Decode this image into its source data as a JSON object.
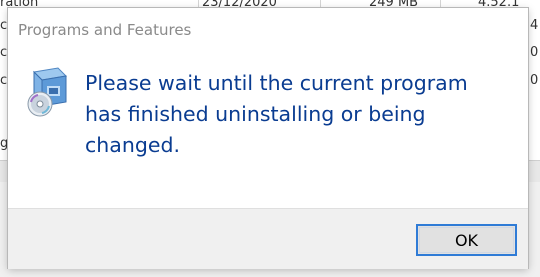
{
  "background_list": {
    "top_row": {
      "name_fragment": "ration",
      "date": "23/12/2020",
      "size": "249 MB",
      "version": "4.52.1"
    },
    "edge_chars_left": [
      "c",
      "c",
      "c",
      "g"
    ],
    "edge_chars_right": [
      "4",
      "0",
      "0"
    ]
  },
  "dialog": {
    "title": "Programs and Features",
    "message": "Please wait until the current program has finished uninstalling or being changed.",
    "icon": "programs-and-features-icon",
    "ok_label": "OK"
  },
  "colors": {
    "message_text": "#0a3c91",
    "title_text": "#8a8a8a",
    "focus_border": "#2f7bd6"
  }
}
